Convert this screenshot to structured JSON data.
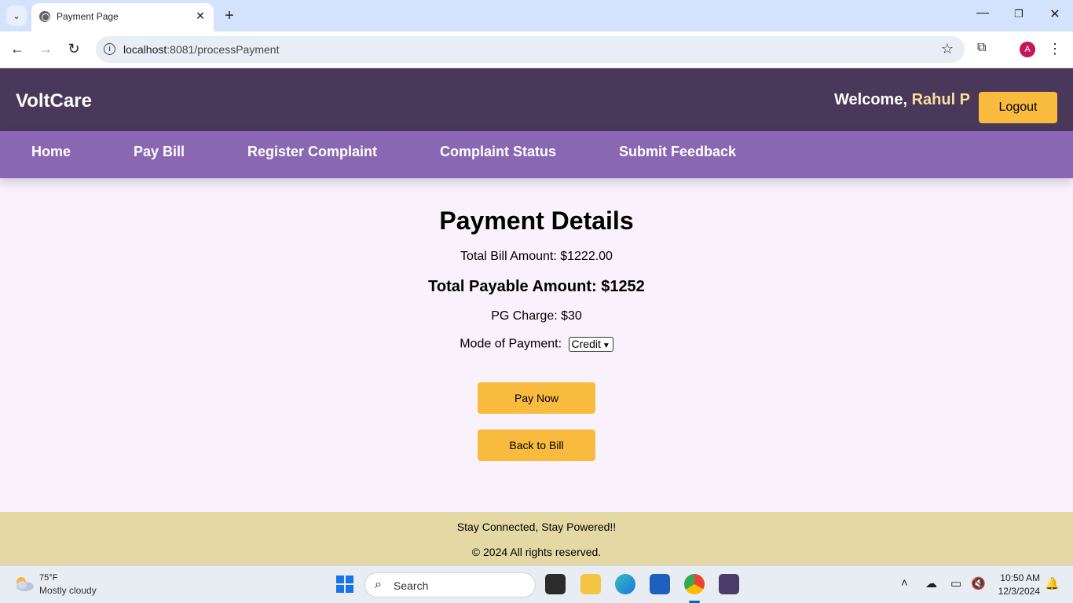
{
  "browser": {
    "tab_title": "Payment Page",
    "url_host": "localhost",
    "url_path": ":8081/processPayment",
    "profile_initial": "A"
  },
  "header": {
    "brand": "VoltCare",
    "welcome_prefix": "Welcome, ",
    "user_name": "Rahul P",
    "logout_label": "Logout"
  },
  "nav": {
    "items": [
      {
        "label": "Home"
      },
      {
        "label": "Pay Bill"
      },
      {
        "label": "Register Complaint"
      },
      {
        "label": "Complaint Status"
      },
      {
        "label": "Submit Feedback"
      }
    ]
  },
  "payment": {
    "title": "Payment Details",
    "total_bill": "Total Bill Amount: $1222.00",
    "total_payable": "Total Payable Amount: $1252",
    "pg_charge": "PG Charge: $30",
    "mode_label": "Mode of Payment:",
    "mode_selected": "Credit",
    "pay_now_label": "Pay Now",
    "back_label": "Back to Bill"
  },
  "footer": {
    "tagline": "Stay Connected, Stay Powered!!",
    "copyright": "© 2024 All rights reserved."
  },
  "taskbar": {
    "weather_temp": "75°F",
    "weather_desc": "Mostly cloudy",
    "search_placeholder": "Search",
    "time": "10:50 AM",
    "date": "12/3/2024"
  },
  "colors": {
    "header_bg": "#49385a",
    "nav_bg": "#8a67b3",
    "accent_button": "#f8bb3d",
    "page_bg": "#f9f1fc",
    "footer_bg": "#e4d9a5",
    "username_color": "#f9dfa0"
  }
}
